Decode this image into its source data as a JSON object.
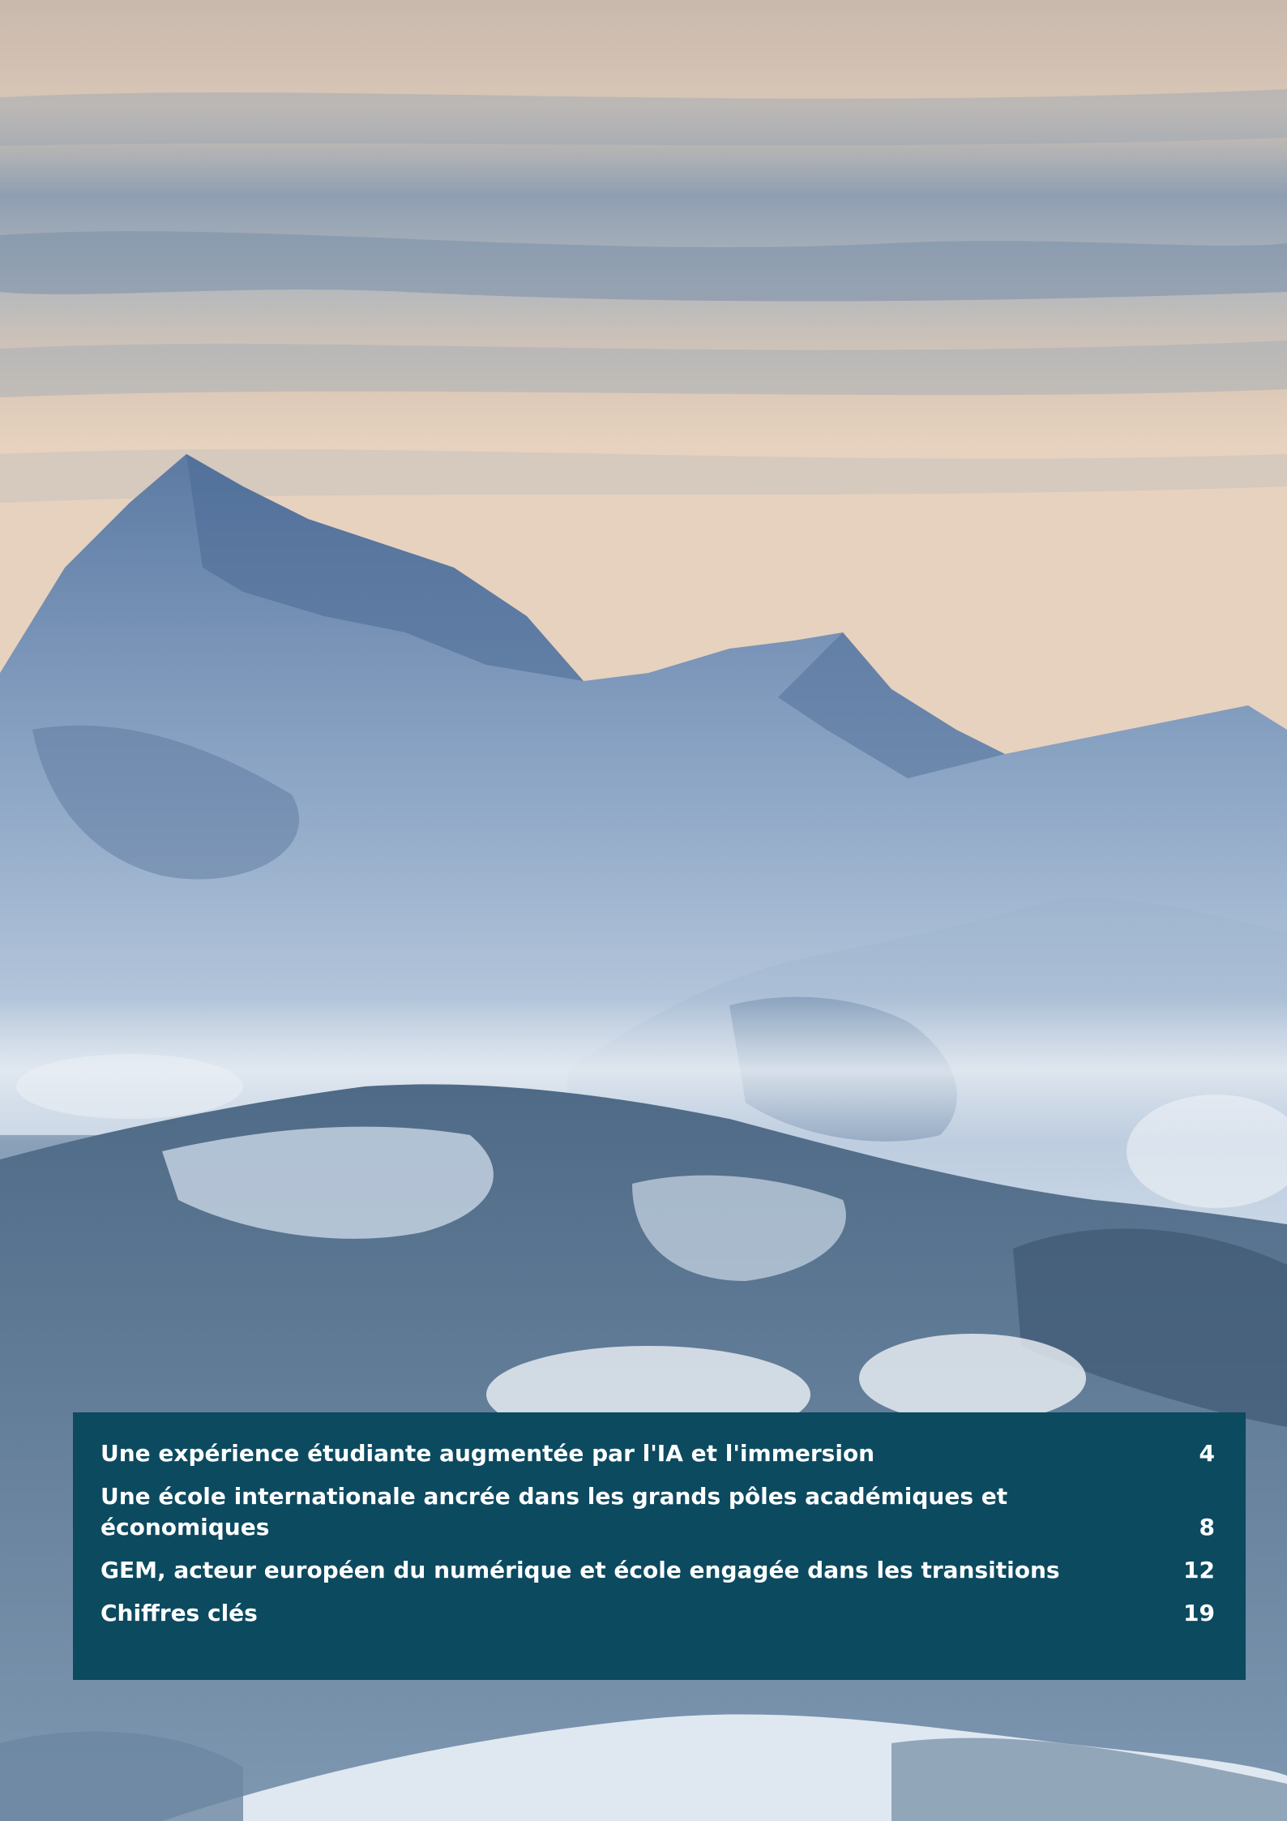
{
  "toc": {
    "entries": [
      {
        "title": "Une expérience étudiante augmentée par l'IA et l'immersion",
        "page": "4"
      },
      {
        "title": "Une école internationale ancrée dans les grands pôles académiques et économiques",
        "page": "8"
      },
      {
        "title": "GEM, acteur européen du numérique et école engagée dans les transitions",
        "page": "12"
      },
      {
        "title": "Chiffres clés",
        "page": "19"
      }
    ]
  }
}
